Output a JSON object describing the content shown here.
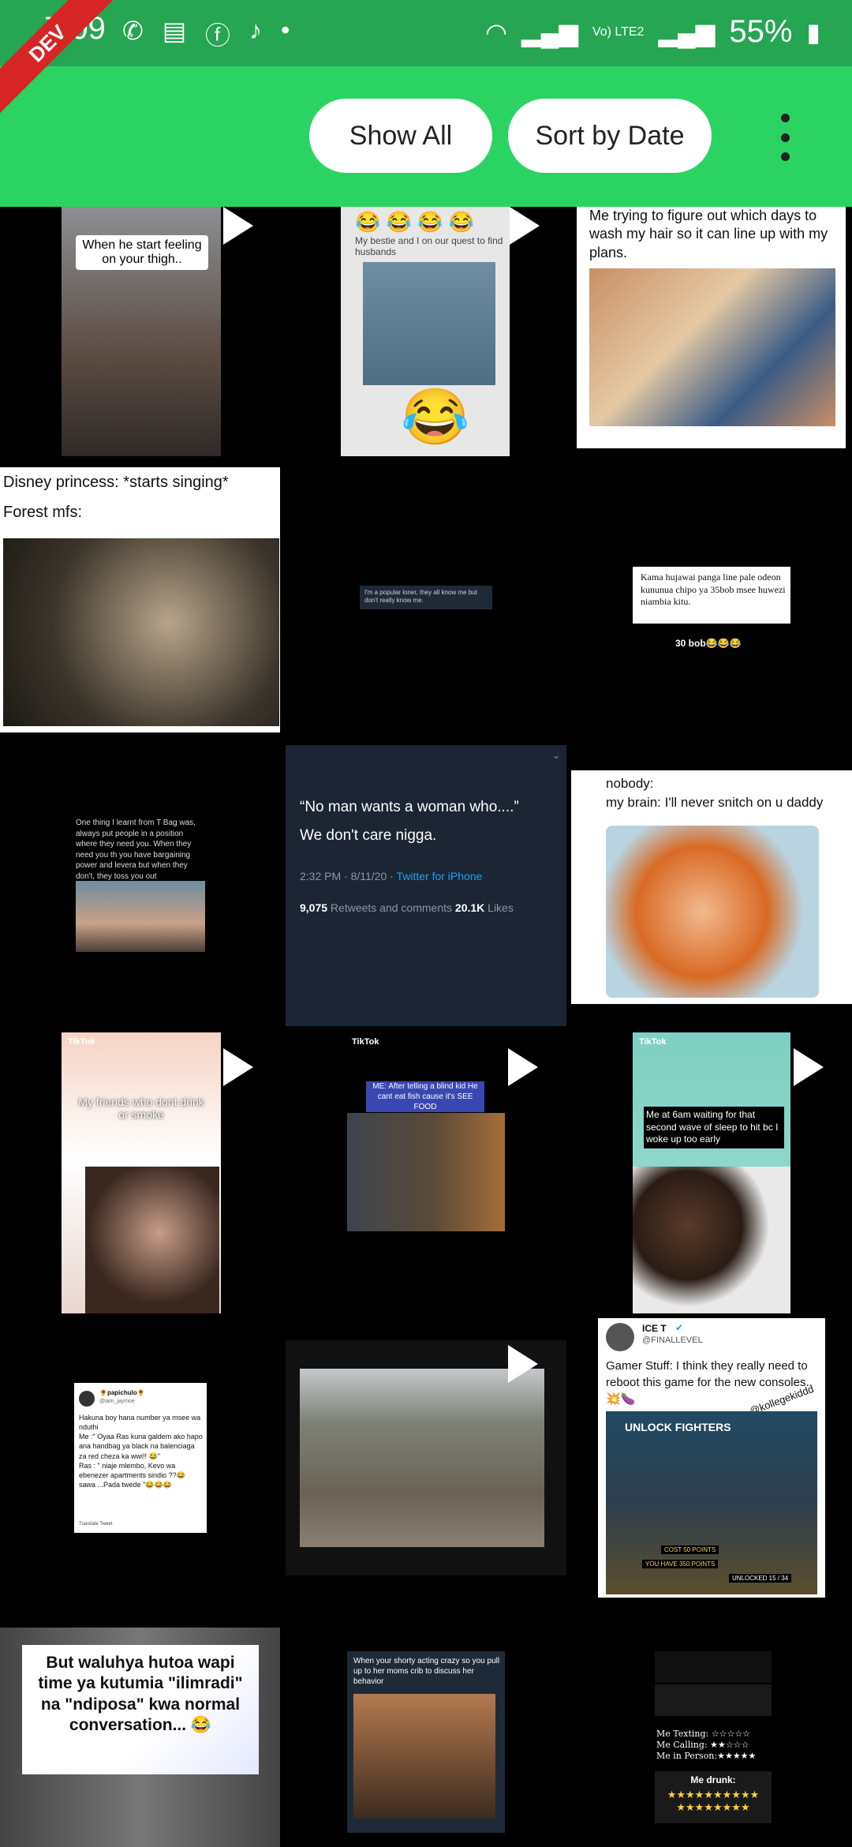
{
  "status": {
    "time": "7:09",
    "network": "Vo) LTE2",
    "battery": "55%",
    "dev_ribbon": "DEV"
  },
  "toolbar": {
    "show_all": "Show All",
    "sort_by_date": "Sort by Date"
  },
  "tiles": {
    "t1": {
      "caption": "When he start feeling on your thigh.."
    },
    "t2": {
      "caption": "My bestie and I on our quest to find husbands",
      "emoji": "😂 😂 😂 😂",
      "big_emoji": "😂"
    },
    "t3": {
      "text": "Me trying to figure out which days to wash my hair so it can line up with my plans."
    },
    "t4": {
      "line1": "Disney princess: *starts singing*",
      "line2": "Forest mfs:"
    },
    "t5": {
      "text": "I'm a popular loner, they all know me but don't really know me."
    },
    "t6": {
      "text": "Kama hujawai panga line pale odeon kununua chipo ya 35bob msee huwezi niambia kitu.",
      "sub": "30 bob😂😂😂"
    },
    "t7": {
      "text": "One thing I learnt from T Bag was, always put people in a position where they need you. When they need you th you have bargaining power and levera but when they don't, they toss you out"
    },
    "t8": {
      "quote": "“No man wants a woman who....”",
      "line2": "We don't care nigga.",
      "meta_time": "2:32 PM · 8/11/20 · ",
      "meta_source": "Twitter for iPhone",
      "retweets": "9,075",
      "retweets_label": " Retweets and comments ",
      "likes": "20.1K",
      "likes_label": " Likes"
    },
    "t9": {
      "line1": "nobody:",
      "line2": "my brain: I'll never snitch on u daddy"
    },
    "t10": {
      "brand": "TikTok",
      "caption": "My friends who dont drink or smoke"
    },
    "t11": {
      "brand": "TikTok",
      "caption": "ME: After telling a blind kid He cant eat fish cause it's SEE FOOD"
    },
    "t12": {
      "brand": "TikTok",
      "caption": "Me at 6am waiting for that second wave of sleep to hit bc I woke up too early"
    },
    "t13": {
      "name": "🌻papichulo🌻",
      "handle": "@iam_jaymoe",
      "text": "Hakuna boy hana number ya msee wa nduthi\nMe :\" Oyaa Ras kuna galdem ako hapo ana handbag ya black na balenciaga za red cheza ka wwi!! 😂\"\nRas : \" niaje mlembo, Kevo wa ebenezer apartments sindio ??😂 sawa ...Pada twede \"😂😂😂",
      "translate": "Translate Tweet"
    },
    "t15": {
      "name": "ICE T",
      "handle": "@FINALLEVEL",
      "text": "Gamer Stuff: I think they really need to reboot this game for the new consoles.. 💥🍆",
      "watermark": "@kollegekiddd",
      "game_title": "UNLOCK FIGHTERS",
      "cost": "COST  50 POINTS",
      "have": "YOU HAVE  350 POINTS",
      "unlocked": "UNLOCKED  15 / 34"
    },
    "t16": {
      "text": "But waluhya hutoa wapi time ya kutumia \"ilimradi\" na \"ndiposa\" kwa normal conversation... 😂"
    },
    "t17": {
      "text": "When your shorty acting crazy so you pull up to her moms crib to discuss her behavior"
    },
    "t18": {
      "texting": "Me Texting: ☆☆☆☆☆",
      "calling": "Me Calling: ★★☆☆☆",
      "person": "Me in Person:★★★★★",
      "drunk_label": "Me drunk:",
      "drunk_stars": "★★★★★★★★★★★★★★★★★★"
    }
  }
}
